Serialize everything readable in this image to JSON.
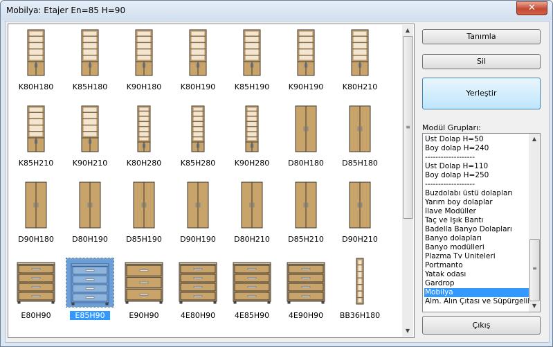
{
  "window": {
    "title": "Mobilya:  Etajer En=85 H=90",
    "close_label": "✕"
  },
  "items": [
    {
      "label": "K80H180",
      "kind": "shelf",
      "selected": false
    },
    {
      "label": "K85H180",
      "kind": "shelf",
      "selected": false
    },
    {
      "label": "K90H180",
      "kind": "shelf",
      "selected": false
    },
    {
      "label": "K80H190",
      "kind": "shelf",
      "selected": false
    },
    {
      "label": "K85H190",
      "kind": "shelf",
      "selected": false
    },
    {
      "label": "K90H190",
      "kind": "shelf",
      "selected": false
    },
    {
      "label": "K80H210",
      "kind": "shelf",
      "selected": false
    },
    {
      "label": "K85H210",
      "kind": "shelf",
      "selected": false
    },
    {
      "label": "K90H210",
      "kind": "shelf",
      "selected": false
    },
    {
      "label": "K80H280",
      "kind": "tallshelf",
      "selected": false
    },
    {
      "label": "K85H280",
      "kind": "tallshelf",
      "selected": false
    },
    {
      "label": "K90H280",
      "kind": "tallshelf",
      "selected": false
    },
    {
      "label": "D80H180",
      "kind": "wardrobe",
      "selected": false
    },
    {
      "label": "D85H180",
      "kind": "wardrobe",
      "selected": false
    },
    {
      "label": "D90H180",
      "kind": "wardrobe",
      "selected": false
    },
    {
      "label": "D80H190",
      "kind": "wardrobe",
      "selected": false
    },
    {
      "label": "D85H190",
      "kind": "wardrobe",
      "selected": false
    },
    {
      "label": "D90H190",
      "kind": "wardrobe",
      "selected": false
    },
    {
      "label": "D80H210",
      "kind": "wardrobe",
      "selected": false
    },
    {
      "label": "D85H210",
      "kind": "wardrobe",
      "selected": false
    },
    {
      "label": "D90H210",
      "kind": "wardrobe",
      "selected": false
    },
    {
      "label": "E80H90",
      "kind": "drawers",
      "selected": false
    },
    {
      "label": "E85H90",
      "kind": "drawers",
      "selected": true
    },
    {
      "label": "E90H90",
      "kind": "drawers3",
      "selected": false
    },
    {
      "label": "4E80H90",
      "kind": "drawers",
      "selected": false
    },
    {
      "label": "4E85H90",
      "kind": "drawers",
      "selected": false
    },
    {
      "label": "4E90H90",
      "kind": "drawers",
      "selected": false
    },
    {
      "label": "BB36H180",
      "kind": "narrow",
      "selected": false
    }
  ],
  "buttons": {
    "define": "Tanımla",
    "delete": "Sil",
    "place": "Yerleştir",
    "exit": "Çıkış"
  },
  "groups_label": "Modül Grupları:",
  "groups": [
    {
      "text": "Üst Dolap H=50",
      "selected": false
    },
    {
      "text": "Boy dolap H=240",
      "selected": false
    },
    {
      "text": "-------------------",
      "selected": false
    },
    {
      "text": "Üst Dolap H=110",
      "selected": false
    },
    {
      "text": "Boy dolap H=250",
      "selected": false
    },
    {
      "text": "-------------------",
      "selected": false
    },
    {
      "text": "Buzdolabı üstü dolapları",
      "selected": false
    },
    {
      "text": "Yarım boy dolaplar",
      "selected": false
    },
    {
      "text": "İlave Modüller",
      "selected": false
    },
    {
      "text": "Taç ve Işık Bantı",
      "selected": false
    },
    {
      "text": "Badella Banyo Dolapları",
      "selected": false
    },
    {
      "text": "Banyo dolapları",
      "selected": false
    },
    {
      "text": "Banyo modülleri",
      "selected": false
    },
    {
      "text": "Plazma Tv Üniteleri",
      "selected": false
    },
    {
      "text": "Portmanto",
      "selected": false
    },
    {
      "text": "Yatak odası",
      "selected": false
    },
    {
      "text": "Gardrop",
      "selected": false
    },
    {
      "text": "Mobilya",
      "selected": true
    },
    {
      "text": "Alm. Alın Çıtası ve Süpürgelikler",
      "selected": false
    }
  ],
  "colors": {
    "wood": "#c9a46a",
    "wood_dark": "#8a6a3e",
    "frame": "#3d3a36",
    "selection": "#3399ff"
  },
  "icons": {
    "scroll_up": "▲",
    "scroll_down": "▼",
    "grip": "≡"
  }
}
